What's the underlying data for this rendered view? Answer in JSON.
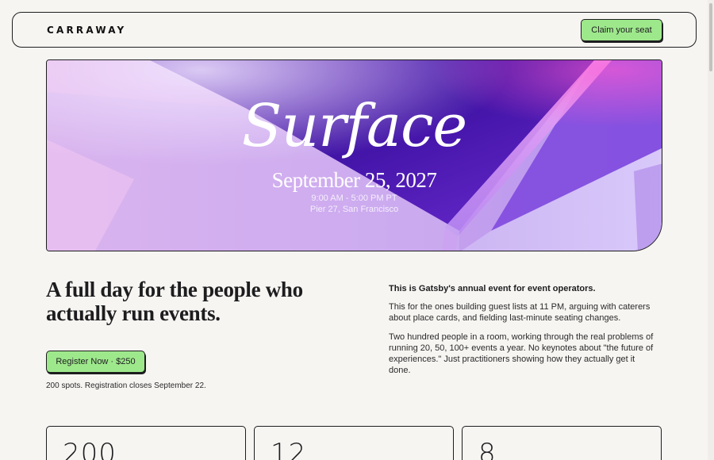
{
  "header": {
    "logo": "CARRAWAY",
    "cta_label": "Claim your seat"
  },
  "hero": {
    "title": "Surface",
    "date": "September 25, 2027",
    "time": "9:00 AM - 5:00 PM PT",
    "location": "Pier 27, San Francisco"
  },
  "intro": {
    "headline": "A full day for the people who actually run events.",
    "register_label": "Register Now · $250",
    "spots_note": "200 spots. Registration closes September 22.",
    "lead": "This is Gatsby's annual event for event operators.",
    "paragraph_1": "This for the ones building guest lists at 11 PM, arguing with caterers about place cards, and fielding last-minute seating changes.",
    "paragraph_2": "Two hundred people in a room, working through the real problems of running 20, 50, 100+ events a year. No keynotes about \"the future of experiences.\" Just practitioners showing how they actually get it done."
  },
  "stats": [
    {
      "value": "200"
    },
    {
      "value": "12"
    },
    {
      "value": "8"
    }
  ],
  "colors": {
    "accent_green": "#9ee88c",
    "background": "#f7f5f2",
    "ink": "#1d1d1f"
  }
}
